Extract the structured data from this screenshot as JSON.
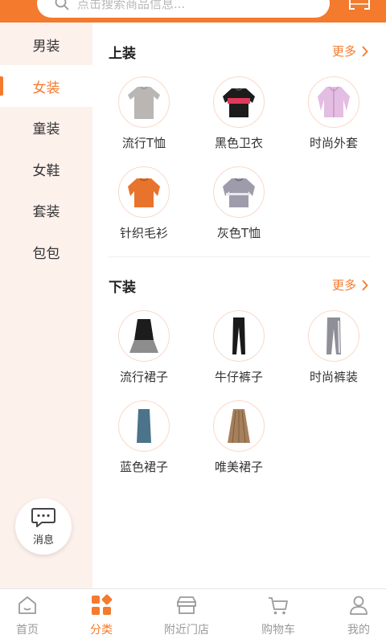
{
  "search": {
    "placeholder": "点击搜索商品信息..."
  },
  "colors": {
    "accent": "#f47a2e",
    "sidebar_bg": "#fdf1ec"
  },
  "sidebar": {
    "items": [
      {
        "label": "男装",
        "active": false
      },
      {
        "label": "女装",
        "active": true
      },
      {
        "label": "童装",
        "active": false
      },
      {
        "label": "女鞋",
        "active": false
      },
      {
        "label": "套装",
        "active": false
      },
      {
        "label": "包包",
        "active": false
      }
    ],
    "message_label": "消息"
  },
  "sections": [
    {
      "title": "上装",
      "more": "更多",
      "items": [
        {
          "label": "流行T恤",
          "icon": "gray-sweater-icon"
        },
        {
          "label": "黑色卫衣",
          "icon": "black-sweatshirt-icon"
        },
        {
          "label": "时尚外套",
          "icon": "pink-jacket-icon"
        },
        {
          "label": "针织毛衫",
          "icon": "orange-sweater-icon"
        },
        {
          "label": "灰色T恤",
          "icon": "gray-striped-top-icon"
        }
      ]
    },
    {
      "title": "下装",
      "more": "更多",
      "items": [
        {
          "label": "流行裙子",
          "icon": "black-skirt-icon"
        },
        {
          "label": "牛仔裤子",
          "icon": "black-pants-icon"
        },
        {
          "label": "时尚裤装",
          "icon": "gray-pants-icon"
        },
        {
          "label": "蓝色裙子",
          "icon": "blue-skirt-icon"
        },
        {
          "label": "唯美裙子",
          "icon": "pleated-skirt-icon"
        }
      ]
    }
  ],
  "bottom_nav": [
    {
      "label": "首页",
      "icon": "home-icon",
      "active": false
    },
    {
      "label": "分类",
      "icon": "category-icon",
      "active": true
    },
    {
      "label": "附近门店",
      "icon": "store-icon",
      "active": false
    },
    {
      "label": "购物车",
      "icon": "cart-icon",
      "active": false
    },
    {
      "label": "我的",
      "icon": "profile-icon",
      "active": false
    }
  ]
}
